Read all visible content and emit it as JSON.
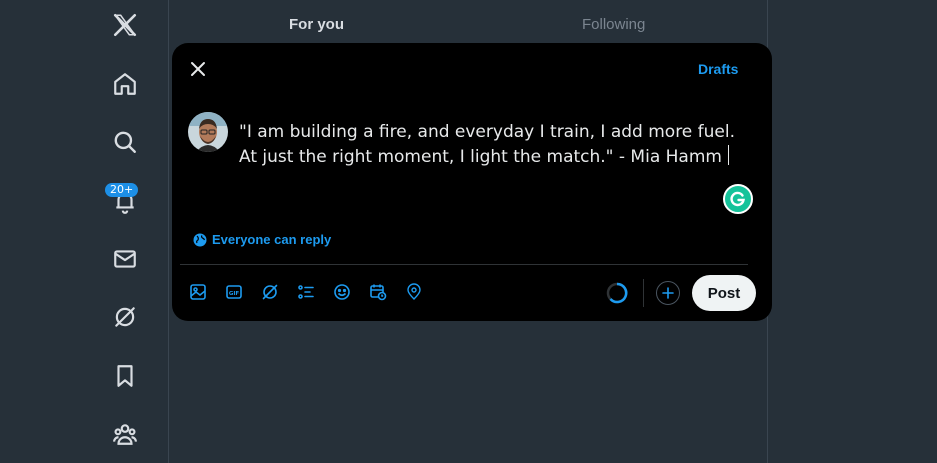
{
  "nav": {
    "items": [
      {
        "icon": "x-logo-icon"
      },
      {
        "icon": "home-icon"
      },
      {
        "icon": "search-icon"
      },
      {
        "icon": "bell-icon",
        "badge": "20+"
      },
      {
        "icon": "mail-icon"
      },
      {
        "icon": "grok-icon"
      },
      {
        "icon": "bookmark-icon"
      },
      {
        "icon": "communities-icon"
      }
    ]
  },
  "feed": {
    "tabs": [
      {
        "label": "For you",
        "active": true
      },
      {
        "label": "Following",
        "active": false
      }
    ]
  },
  "compose": {
    "drafts_label": "Drafts",
    "text": "\"I am building a fire, and everyday I train, I add more fuel.\nAt just the right moment, I light the match.\" - Mia Hamm",
    "reply_setting": "Everyone can reply",
    "toolbar_icons": [
      "media-icon",
      "gif-icon",
      "grok-icon",
      "poll-icon",
      "emoji-icon",
      "schedule-icon",
      "location-icon"
    ],
    "post_label": "Post"
  },
  "colors": {
    "accent": "#1d9bf0",
    "background": "#263039",
    "modal": "#000000",
    "badge": "#1d8fe6"
  }
}
